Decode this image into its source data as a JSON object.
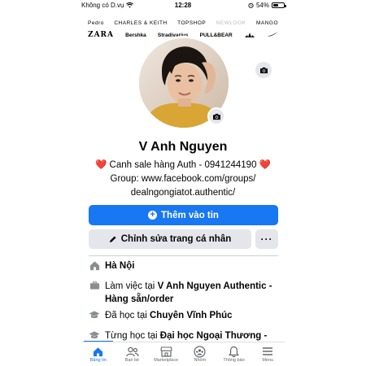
{
  "status_bar": {
    "carrier": "Không có D.vụ",
    "time": "12:28",
    "battery": "54%",
    "battery_level": 0.54
  },
  "cover": {
    "brands_row1": [
      "Pedro",
      "CHARLES & KEITH",
      "TOPSHOP",
      "NEWLOOK",
      "MANGO"
    ],
    "brands_row2": [
      "ZARA",
      "Bershka",
      "Stradivarius",
      "PULL&BEAR",
      "adidas",
      "nike-swoosh"
    ]
  },
  "profile": {
    "name": "V Anh Nguyen",
    "bio_line1": "Canh sale hàng Auth - 0941244190",
    "bio_line2": "Group: www.facebook.com/groups/",
    "bio_line3": "dealngongiatot.authentic/"
  },
  "actions": {
    "add_story": "Thêm vào tin",
    "edit_profile": "Chỉnh sửa trang cá nhân",
    "more": "···"
  },
  "details": [
    {
      "icon": "home-icon",
      "prefix": "",
      "bold": "Hà Nội",
      "suffix": ""
    },
    {
      "icon": "briefcase-icon",
      "prefix": "Làm việc tại ",
      "bold": "V Anh Nguyen Authentic - Hàng sẵn/order",
      "suffix": ""
    },
    {
      "icon": "graduation-cap-icon",
      "prefix": "Đã học tại ",
      "bold": "Chuyên Vĩnh Phúc",
      "suffix": ""
    },
    {
      "icon": "graduation-cap-icon",
      "prefix": "Từng học tại ",
      "bold": "Đại học Ngoại Thương -",
      "suffix": ""
    }
  ],
  "tabbar": [
    {
      "icon": "home-icon",
      "label": "Bảng tin",
      "active": true
    },
    {
      "icon": "friends-icon",
      "label": "Bạn bè",
      "active": false
    },
    {
      "icon": "marketplace-icon",
      "label": "Marketplace",
      "active": false
    },
    {
      "icon": "groups-icon",
      "label": "Nhóm",
      "active": false
    },
    {
      "icon": "bell-icon",
      "label": "Thông báo",
      "active": false
    },
    {
      "icon": "menu-icon",
      "label": "Menu",
      "active": false
    }
  ],
  "colors": {
    "accent": "#1877f2",
    "secondary_button": "#e4e6eb",
    "heart": "#e02424"
  }
}
